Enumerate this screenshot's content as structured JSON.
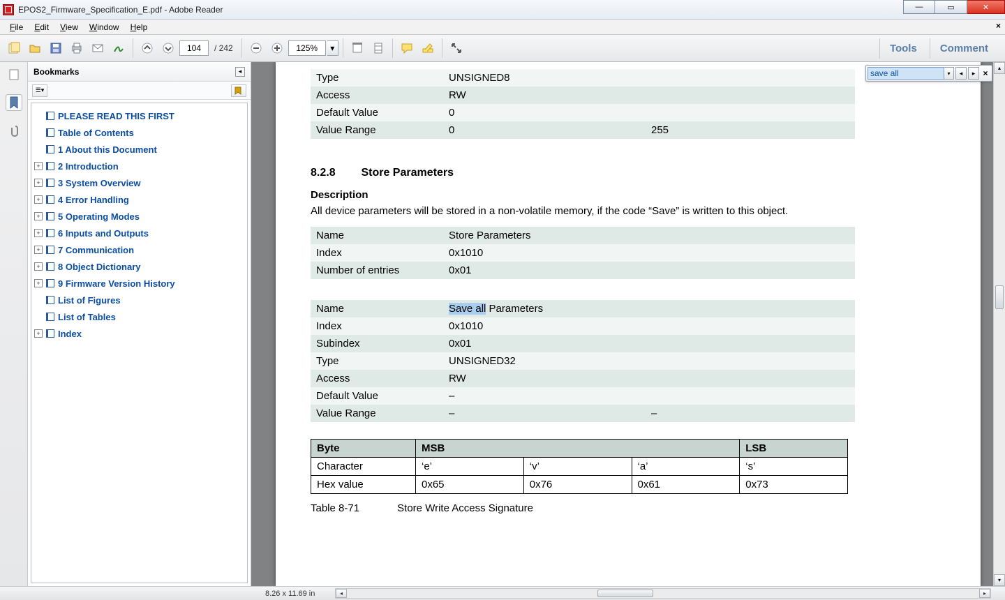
{
  "window": {
    "title": "EPOS2_Firmware_Specification_E.pdf - Adobe Reader"
  },
  "menu": {
    "file": "File",
    "edit": "Edit",
    "view": "View",
    "window": "Window",
    "help": "Help"
  },
  "toolbar": {
    "page_current": "104",
    "page_total": "/ 242",
    "zoom": "125%",
    "tools": "Tools",
    "comment": "Comment"
  },
  "find": {
    "query": "save all"
  },
  "panel": {
    "title": "Bookmarks"
  },
  "bookmarks": [
    {
      "exp": "",
      "label": "PLEASE READ THIS FIRST"
    },
    {
      "exp": "",
      "label": "Table of Contents"
    },
    {
      "exp": "",
      "label": "1 About this Document"
    },
    {
      "exp": "+",
      "label": "2 Introduction"
    },
    {
      "exp": "+",
      "label": "3 System Overview"
    },
    {
      "exp": "+",
      "label": "4 Error Handling"
    },
    {
      "exp": "+",
      "label": "5 Operating Modes"
    },
    {
      "exp": "+",
      "label": "6 Inputs and Outputs"
    },
    {
      "exp": "+",
      "label": "7 Communication"
    },
    {
      "exp": "+",
      "label": "8 Object Dictionary"
    },
    {
      "exp": "+",
      "label": "9 Firmware Version History"
    },
    {
      "exp": "",
      "label": "List of Figures"
    },
    {
      "exp": "",
      "label": "List of Tables"
    },
    {
      "exp": "+",
      "label": "Index"
    }
  ],
  "doc": {
    "top_rows": [
      {
        "cls": "a",
        "c1": "Type",
        "c2": "UNSIGNED8",
        "c3": ""
      },
      {
        "cls": "h",
        "c1": "Access",
        "c2": "RW",
        "c3": ""
      },
      {
        "cls": "a",
        "c1": "Default Value",
        "c2": "0",
        "c3": ""
      },
      {
        "cls": "h",
        "c1": "Value Range",
        "c2": "0",
        "c3": "255"
      }
    ],
    "sec_num": "8.2.8",
    "sec_title": "Store Parameters",
    "desc_h": "Description",
    "desc_p": "All device parameters will be stored in a non-volatile memory, if the code “Save” is written to this object.",
    "tblA": [
      {
        "cls": "h",
        "c1": "Name",
        "c2": "Store Parameters"
      },
      {
        "cls": "a",
        "c1": "Index",
        "c2": "0x1010"
      },
      {
        "cls": "h",
        "c1": "Number of entries",
        "c2": "0x01"
      }
    ],
    "tblB_name_label": "Name",
    "tblB_name_hl": "Save all",
    "tblB_name_rest": " Parameters",
    "tblB": [
      {
        "cls": "a",
        "c1": "Index",
        "c2": "0x1010",
        "c3": ""
      },
      {
        "cls": "h",
        "c1": "Subindex",
        "c2": "0x01",
        "c3": ""
      },
      {
        "cls": "a",
        "c1": "Type",
        "c2": "UNSIGNED32",
        "c3": ""
      },
      {
        "cls": "h",
        "c1": "Access",
        "c2": "RW",
        "c3": ""
      },
      {
        "cls": "a",
        "c1": "Default Value",
        "c2": "–",
        "c3": ""
      },
      {
        "cls": "h",
        "c1": "Value Range",
        "c2": "–",
        "c3": "–"
      }
    ],
    "byte_h": {
      "b": "Byte",
      "m": "MSB",
      "l": "LSB"
    },
    "byte_rows": [
      {
        "r": "Character",
        "a": "‘e’",
        "b": "‘v’",
        "c": "‘a’",
        "d": "‘s’"
      },
      {
        "r": "Hex value",
        "a": "0x65",
        "b": "0x76",
        "c": "0x61",
        "d": "0x73"
      }
    ],
    "caption_n": "Table 8-71",
    "caption_t": "Store Write Access Signature"
  },
  "status": {
    "dims": "8.26 x 11.69 in"
  }
}
